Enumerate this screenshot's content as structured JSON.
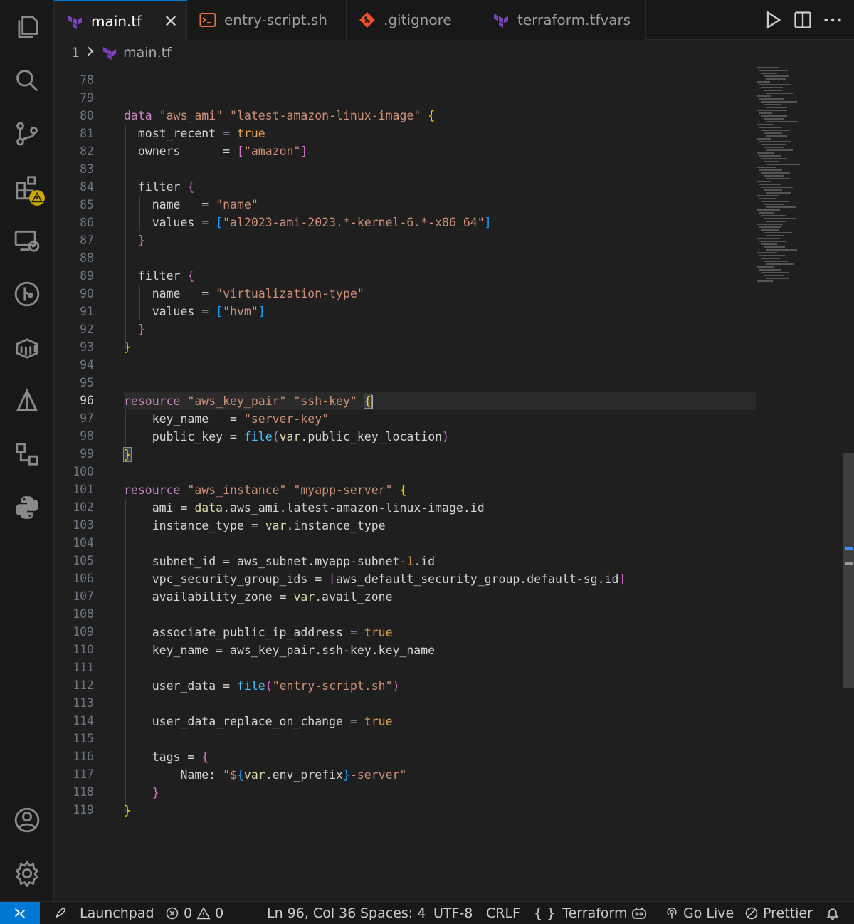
{
  "tabs": [
    {
      "label": "main.tf",
      "icon": "terraform-icon",
      "active": true
    },
    {
      "label": "entry-script.sh",
      "icon": "terminal-icon",
      "active": false
    },
    {
      "label": ".gitignore",
      "icon": "git-icon",
      "active": false
    },
    {
      "label": "terraform.tfvars",
      "icon": "terraform-icon",
      "active": false
    }
  ],
  "breadcrumb": {
    "index": "1",
    "file": "main.tf"
  },
  "editor": {
    "current_line": "96",
    "line_numbers": [
      "78",
      "79",
      "80",
      "81",
      "82",
      "83",
      "84",
      "85",
      "86",
      "87",
      "88",
      "89",
      "90",
      "91",
      "92",
      "93",
      "94",
      "95",
      "96",
      "97",
      "98",
      "99",
      "100",
      "101",
      "102",
      "103",
      "104",
      "105",
      "106",
      "107",
      "108",
      "109",
      "110",
      "111",
      "112",
      "113",
      "114",
      "115",
      "116",
      "117",
      "118",
      "119"
    ],
    "tokens": {
      "l80": [
        "data",
        " ",
        "\"aws_ami\"",
        " ",
        "\"latest-amazon-linux-image\"",
        " ",
        "{"
      ],
      "l81": [
        "  most_recent",
        " = ",
        "true"
      ],
      "l82": [
        "  owners",
        "      = ",
        "[",
        "\"amazon\"",
        "]"
      ],
      "l84": [
        "  filter",
        " ",
        "{"
      ],
      "l85": [
        "    name",
        "   = ",
        "\"name\""
      ],
      "l86": [
        "    values",
        " = ",
        "[",
        "\"al2023-ami-2023.*-kernel-6.*-x86_64\"",
        "]"
      ],
      "l87": [
        "  ",
        "}"
      ],
      "l89": [
        "  filter",
        " ",
        "{"
      ],
      "l90": [
        "    name",
        "   = ",
        "\"virtualization-type\""
      ],
      "l91": [
        "    values",
        " = ",
        "[",
        "\"hvm\"",
        "]"
      ],
      "l92": [
        "  ",
        "}"
      ],
      "l93": [
        "}"
      ],
      "l96": [
        "resource",
        " ",
        "\"aws_key_pair\"",
        " ",
        "\"ssh-key\"",
        " ",
        "{"
      ],
      "l97": [
        "    key_name",
        "   = ",
        "\"server-key\""
      ],
      "l98": [
        "    public_key",
        " = ",
        "file",
        "(",
        "var",
        ".public_key_location",
        ")"
      ],
      "l99": [
        "}"
      ],
      "l101": [
        "resource",
        " ",
        "\"aws_instance\"",
        " ",
        "\"myapp-server\"",
        " ",
        "{"
      ],
      "l102": [
        "    ami",
        " = ",
        "data",
        ".aws_ami.latest-amazon-linux-image.id"
      ],
      "l103": [
        "    instance_type",
        " = ",
        "var",
        ".instance_type"
      ],
      "l105": [
        "    subnet_id",
        " = ",
        "aws_subnet.myapp-subnet-",
        "1",
        ".id"
      ],
      "l106": [
        "    vpc_security_group_ids",
        " = ",
        "[",
        "aws_default_security_group.default-sg.id",
        "]"
      ],
      "l107": [
        "    availability_zone",
        " = ",
        "var",
        ".avail_zone"
      ],
      "l109": [
        "    associate_public_ip_address",
        " = ",
        "true"
      ],
      "l110": [
        "    key_name",
        " = ",
        "aws_key_pair.ssh-key.key_name"
      ],
      "l112": [
        "    user_data",
        " = ",
        "file",
        "(",
        "\"entry-script.sh\"",
        ")"
      ],
      "l114": [
        "    user_data_replace_on_change",
        " = ",
        "true"
      ],
      "l116": [
        "    tags",
        " = ",
        "{"
      ],
      "l117": [
        "        Name",
        ": ",
        "\"$",
        "{",
        "var",
        ".env_prefix",
        "}",
        "-server\""
      ],
      "l118": [
        "    ",
        "}"
      ],
      "l119": [
        "}"
      ]
    }
  },
  "statusbar": {
    "launchpad": "Launchpad",
    "errors": "0",
    "warnings": "0",
    "position": "Ln 96, Col 36",
    "spaces": "Spaces: 4",
    "encoding": "UTF-8",
    "eol": "CRLF",
    "language": "Terraform",
    "golive": "Go Live",
    "prettier": "Prettier"
  },
  "colors": {
    "accent": "#0078d4",
    "terraform": "#7b42bc",
    "shell": "#e8743b",
    "git": "#f1502f",
    "warning": "#cca700"
  }
}
